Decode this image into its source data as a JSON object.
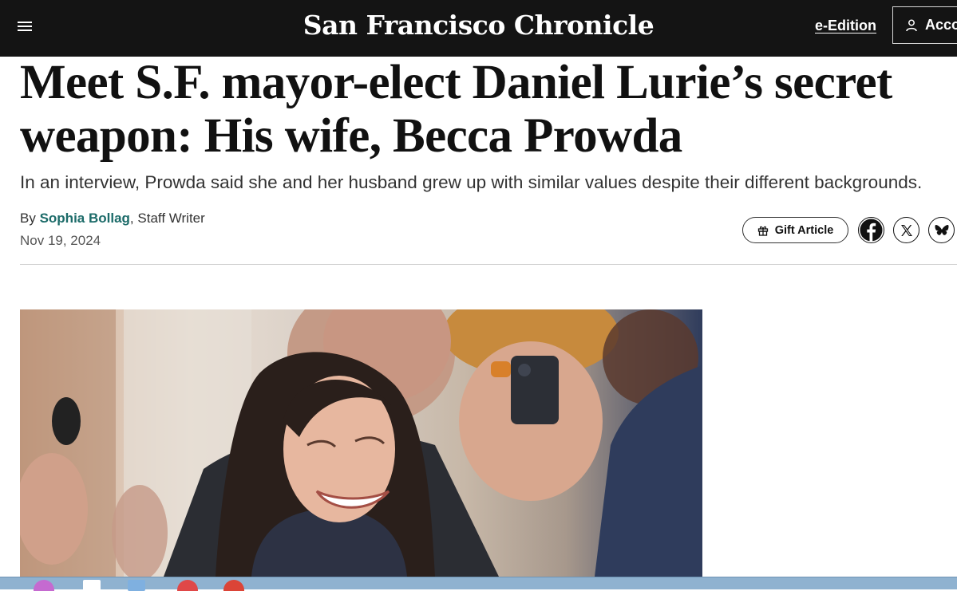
{
  "header": {
    "logo": "San Francisco Chronicle",
    "eedition_label": "e-Edition",
    "account_label": "Acco"
  },
  "article": {
    "headline": "Meet S.F. mayor-elect Daniel Lurie’s secret weapon: His wife, Becca Prowda",
    "dek": "In an interview, Prowda said she and her husband grew up with similar values despite their different backgrounds.",
    "byline_prefix": "By",
    "author": "Sophia Bollag",
    "author_role": "Staff Writer",
    "date": "Nov 19, 2024"
  },
  "share": {
    "gift_label": "Gift Article",
    "icons": [
      "facebook-icon",
      "x-icon",
      "bluesky-icon"
    ]
  },
  "colors": {
    "nav_bg": "#141414",
    "author_link": "#1c6b69",
    "taskbar": "#8fb2d0"
  }
}
